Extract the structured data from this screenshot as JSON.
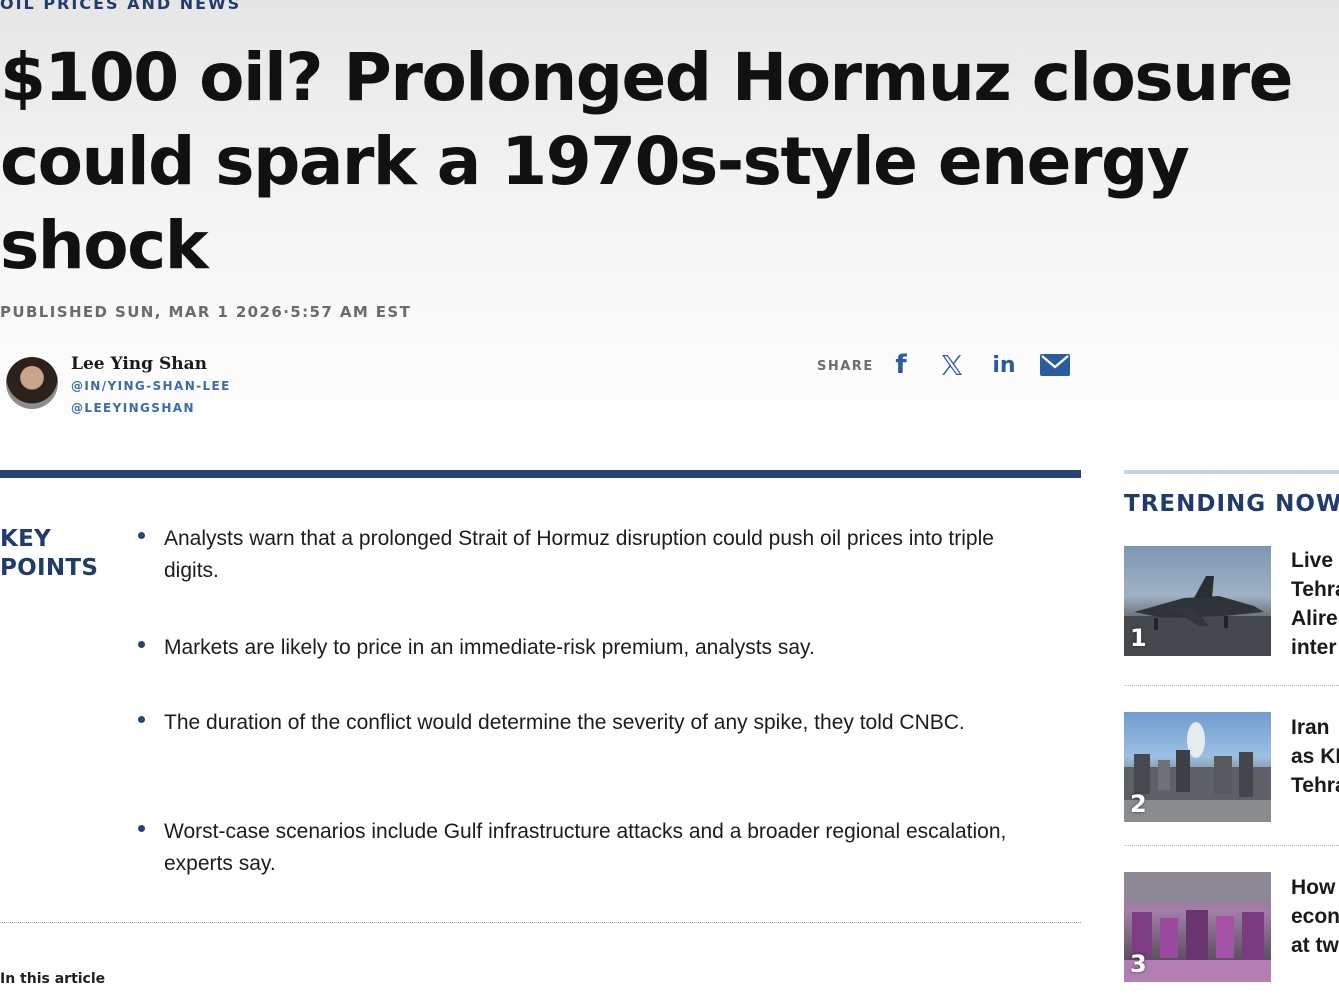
{
  "header": {
    "eyebrow": "OIL PRICES AND NEWS",
    "headline": "$100 oil? Prolonged Hormuz closure could spark a 1970s-style energy shock",
    "published": "PUBLISHED SUN, MAR 1 2026·5:57 AM EST"
  },
  "author": {
    "name": "Lee Ying Shan",
    "linkedin": "@IN/YING-SHAN-LEE",
    "twitter": "@LEEYINGSHAN"
  },
  "share": {
    "label": "SHARE",
    "icons": [
      "facebook-icon",
      "x-icon",
      "linkedin-icon",
      "email-icon"
    ],
    "facebook_glyph": "f",
    "linkedin_glyph": "in"
  },
  "key_points": {
    "label_line1": "KEY",
    "label_line2": "POINTS",
    "items": [
      "Analysts warn that a prolonged Strait of Hormuz disruption could push oil prices into triple digits.",
      "Markets are likely to price in an immediate-risk premium, analysts say.",
      "The duration of the conflict would determine the severity of any spike, they told CNBC.",
      "Worst-case scenarios include Gulf infrastructure attacks and a broader regional escalation, experts say."
    ]
  },
  "in_this_article": "In this article",
  "trending": {
    "title": "TRENDING NOW",
    "items": [
      {
        "num": "1",
        "lines": [
          "Live",
          "Tehra",
          "Alire",
          "inter"
        ]
      },
      {
        "num": "2",
        "lines": [
          "Iran",
          "as KI",
          "Tehra"
        ]
      },
      {
        "num": "3",
        "lines": [
          "How",
          "econ",
          "at tw"
        ]
      }
    ]
  },
  "colors": {
    "brand_navy": "#1f3c6d",
    "rule_navy": "#26456f",
    "link_blue": "#3a6da8",
    "share_blue": "#2b5c9e"
  }
}
